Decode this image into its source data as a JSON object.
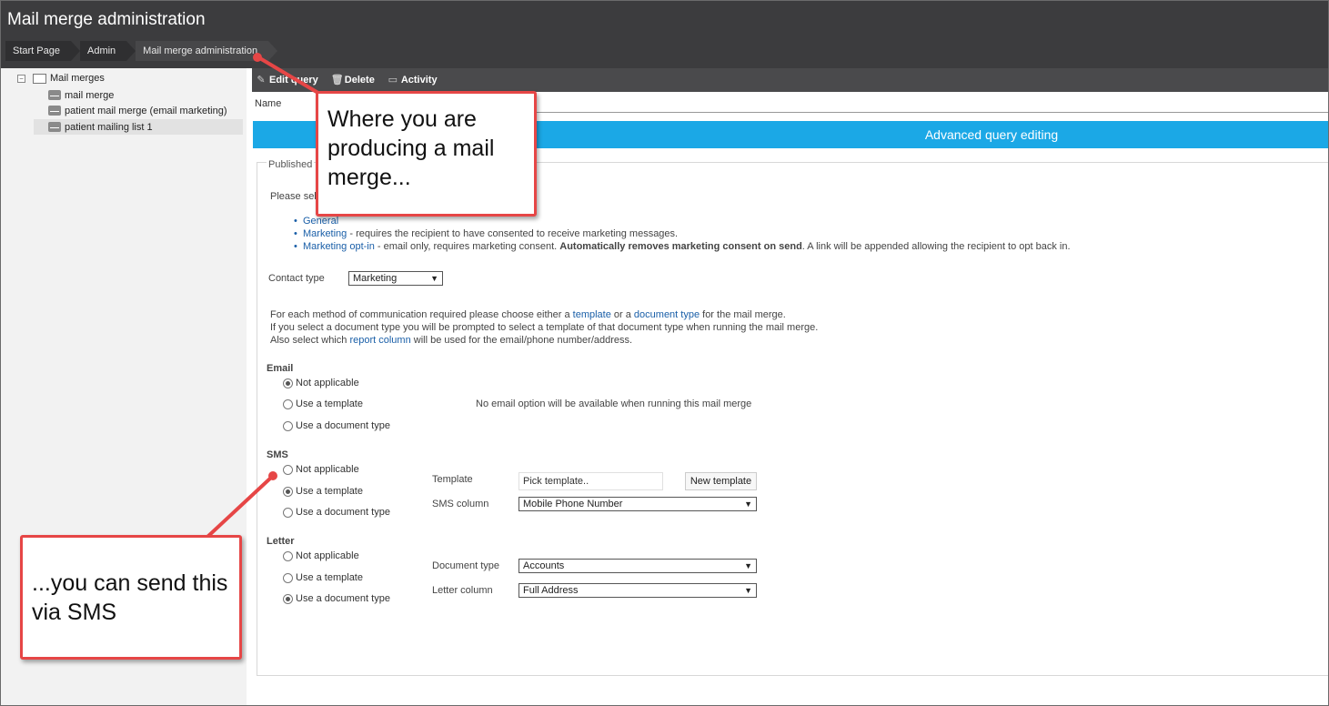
{
  "app": {
    "title": "Mail merge administration"
  },
  "breadcrumb": [
    "Start Page",
    "Admin",
    "Mail merge administration"
  ],
  "sidebar": {
    "root": "Mail merges",
    "items": [
      "mail merge",
      "patient mail merge (email marketing)",
      "patient mailing list 1"
    ],
    "selected_index": 2
  },
  "toolbar": {
    "edit": "Edit query",
    "delete": "Delete",
    "activity": "Activity"
  },
  "form": {
    "name_label": "Name",
    "name_value": "",
    "advanced_label": "Advanced query editing",
    "legend": "Published",
    "intro": "Please sele",
    "contact_types": {
      "general": "General",
      "marketing": "Marketing",
      "marketing_desc": " - requires the recipient to have consented to receive marketing messages.",
      "optin": "Marketing opt-in",
      "optin_desc1": " - email only, requires marketing consent. ",
      "optin_bold": "Automatically removes marketing consent on send",
      "optin_desc2": ". A link will be appended allowing the recipient to opt back in."
    },
    "contact_type_label": "Contact type",
    "contact_type_value": "Marketing",
    "help": {
      "line1_a": "For each method of communication required please choose either a ",
      "line1_link1": "template",
      "line1_b": " or a ",
      "line1_link2": "document type",
      "line1_c": " for the mail merge.",
      "line2": "If you select a document type you will be prompted to select a template of that document type when running the mail merge.",
      "line3_a": "Also select which ",
      "line3_link": "report column",
      "line3_b": " will be used for the email/phone number/address."
    },
    "options": [
      "Not applicable",
      "Use a template",
      "Use a document type"
    ],
    "email": {
      "label": "Email",
      "selected": 0,
      "note": "No email option will be available when running this mail merge"
    },
    "sms": {
      "label": "SMS",
      "selected": 1,
      "template_label": "Template",
      "template_placeholder": "Pick template..",
      "new_template": "New template",
      "column_label": "SMS column",
      "column_value": "Mobile Phone Number"
    },
    "letter": {
      "label": "Letter",
      "selected": 2,
      "doctype_label": "Document type",
      "doctype_value": "Accounts",
      "column_label": "Letter column",
      "column_value": "Full Address"
    }
  },
  "callouts": {
    "top": "Where you are producing a mail merge...",
    "bottom": "...you can send this via SMS"
  },
  "colors": {
    "accent": "#1ba8e6",
    "callout_border": "#e64646",
    "header": "#3c3c3e"
  }
}
